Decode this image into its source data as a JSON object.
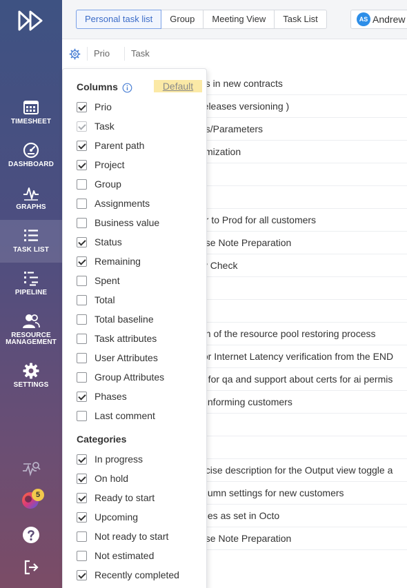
{
  "sidebar": {
    "items": [
      {
        "label": "TIMESHEET",
        "icon": "calendar-icon"
      },
      {
        "label": "DASHBOARD",
        "icon": "speedometer-icon"
      },
      {
        "label": "GRAPHS",
        "icon": "graph-icon"
      },
      {
        "label": "TASK LIST",
        "icon": "list-icon"
      },
      {
        "label": "PIPELINE",
        "icon": "pipeline-icon"
      },
      {
        "label": "RESOURCE\nMANAGEMENT",
        "label_line1": "RESOURCE",
        "label_line2": "MANAGEMENT",
        "icon": "people-icon"
      },
      {
        "label": "SETTINGS",
        "icon": "gear-icon"
      }
    ],
    "active": "TASK LIST",
    "notification_count": "5"
  },
  "topbar": {
    "tabs": [
      "Personal task list",
      "Group",
      "Meeting View",
      "Task List"
    ],
    "active_tab": "Personal task list",
    "user": {
      "initials": "AS",
      "name": "Andrew"
    }
  },
  "table": {
    "headers": {
      "prio": "Prio",
      "task": "Task"
    },
    "rows": [
      "es in new contracts",
      "releases versioning )",
      "es/Parameters",
      "timization",
      "",
      "",
      "er to Prod for all customers",
      "ase Note Preparation",
      "ty Check",
      "",
      "",
      "on of the resource pool restoring process",
      "for Internet Latency verification from the END",
      "n for qa and support about certs for ai permis",
      "f informing customers",
      "",
      "",
      "ecise description for the Output view toggle a",
      "olumn settings for new customers",
      "oles as set in Octo",
      "ase Note Preparation"
    ]
  },
  "columns_panel": {
    "title": "Columns",
    "default_label": "Default",
    "columns": [
      {
        "label": "Prio",
        "checked": true
      },
      {
        "label": "Task",
        "checked": true,
        "disabled": true
      },
      {
        "label": "Parent path",
        "checked": true
      },
      {
        "label": "Project",
        "checked": true
      },
      {
        "label": "Group",
        "checked": false
      },
      {
        "label": "Assignments",
        "checked": false
      },
      {
        "label": "Business value",
        "checked": false
      },
      {
        "label": "Status",
        "checked": true
      },
      {
        "label": "Remaining",
        "checked": true
      },
      {
        "label": "Spent",
        "checked": false
      },
      {
        "label": "Total",
        "checked": false
      },
      {
        "label": "Total baseline",
        "checked": false
      },
      {
        "label": "Task attributes",
        "checked": false
      },
      {
        "label": "User Attributes",
        "checked": false
      },
      {
        "label": "Group Attributes",
        "checked": false
      },
      {
        "label": "Phases",
        "checked": true
      },
      {
        "label": "Last comment",
        "checked": false
      }
    ],
    "categories_title": "Categories",
    "categories": [
      {
        "label": "In progress",
        "checked": true
      },
      {
        "label": "On hold",
        "checked": true
      },
      {
        "label": "Ready to start",
        "checked": true
      },
      {
        "label": "Upcoming",
        "checked": true
      },
      {
        "label": "Not ready to start",
        "checked": false
      },
      {
        "label": "Not estimated",
        "checked": false
      },
      {
        "label": "Recently completed",
        "checked": true
      }
    ]
  }
}
